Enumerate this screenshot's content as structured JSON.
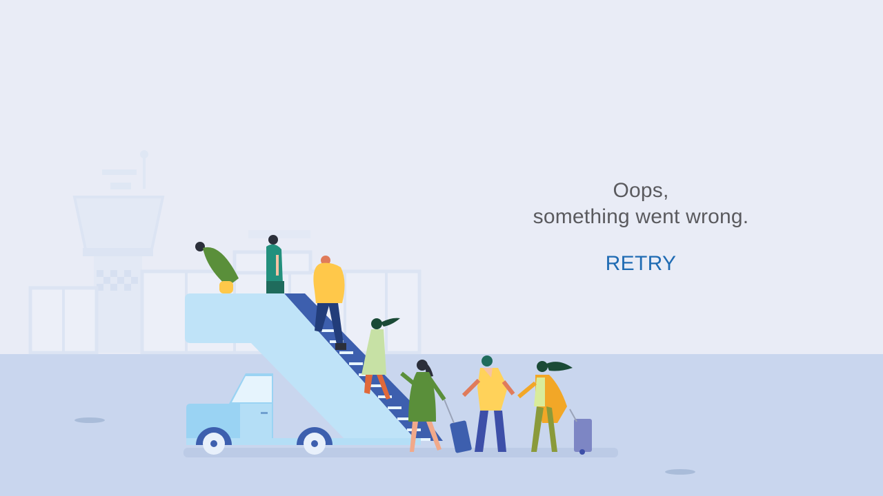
{
  "error": {
    "line1": "Oops,",
    "line2": "something went wrong."
  },
  "actions": {
    "retry_label": "RETRY"
  },
  "illustration": {
    "subject": "passengers-boarding-airplane-stairs",
    "colors": {
      "sky": "#e9ecf6",
      "ground": "#c9d6ee",
      "stairs": "#bfe3f8",
      "stairs_rail": "#3d5fae",
      "truck": "#9ad3f3",
      "accent_link": "#1f6bb3"
    }
  }
}
